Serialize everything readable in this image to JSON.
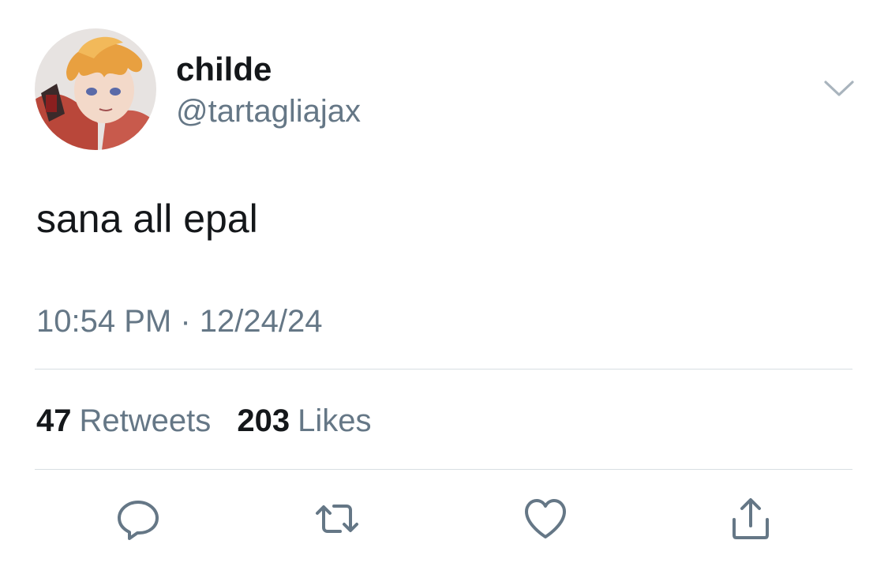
{
  "tweet": {
    "author": {
      "display_name": "childe",
      "handle": "@tartagliajax",
      "avatar_icon": "profile-avatar"
    },
    "text": "sana all epal",
    "timestamp": "10:54 PM · 12/24/24",
    "stats": {
      "retweets_count": "47",
      "retweets_label": "Retweets",
      "likes_count": "203",
      "likes_label": "Likes"
    },
    "actions": [
      {
        "icon": "reply-icon"
      },
      {
        "icon": "retweet-icon"
      },
      {
        "icon": "heart-icon"
      },
      {
        "icon": "share-icon"
      }
    ],
    "menu_icon": "chevron-down-icon"
  },
  "colors": {
    "primary_text": "#14171a",
    "secondary_text": "#657786",
    "divider": "#d8dee3",
    "icon": "#657786"
  }
}
